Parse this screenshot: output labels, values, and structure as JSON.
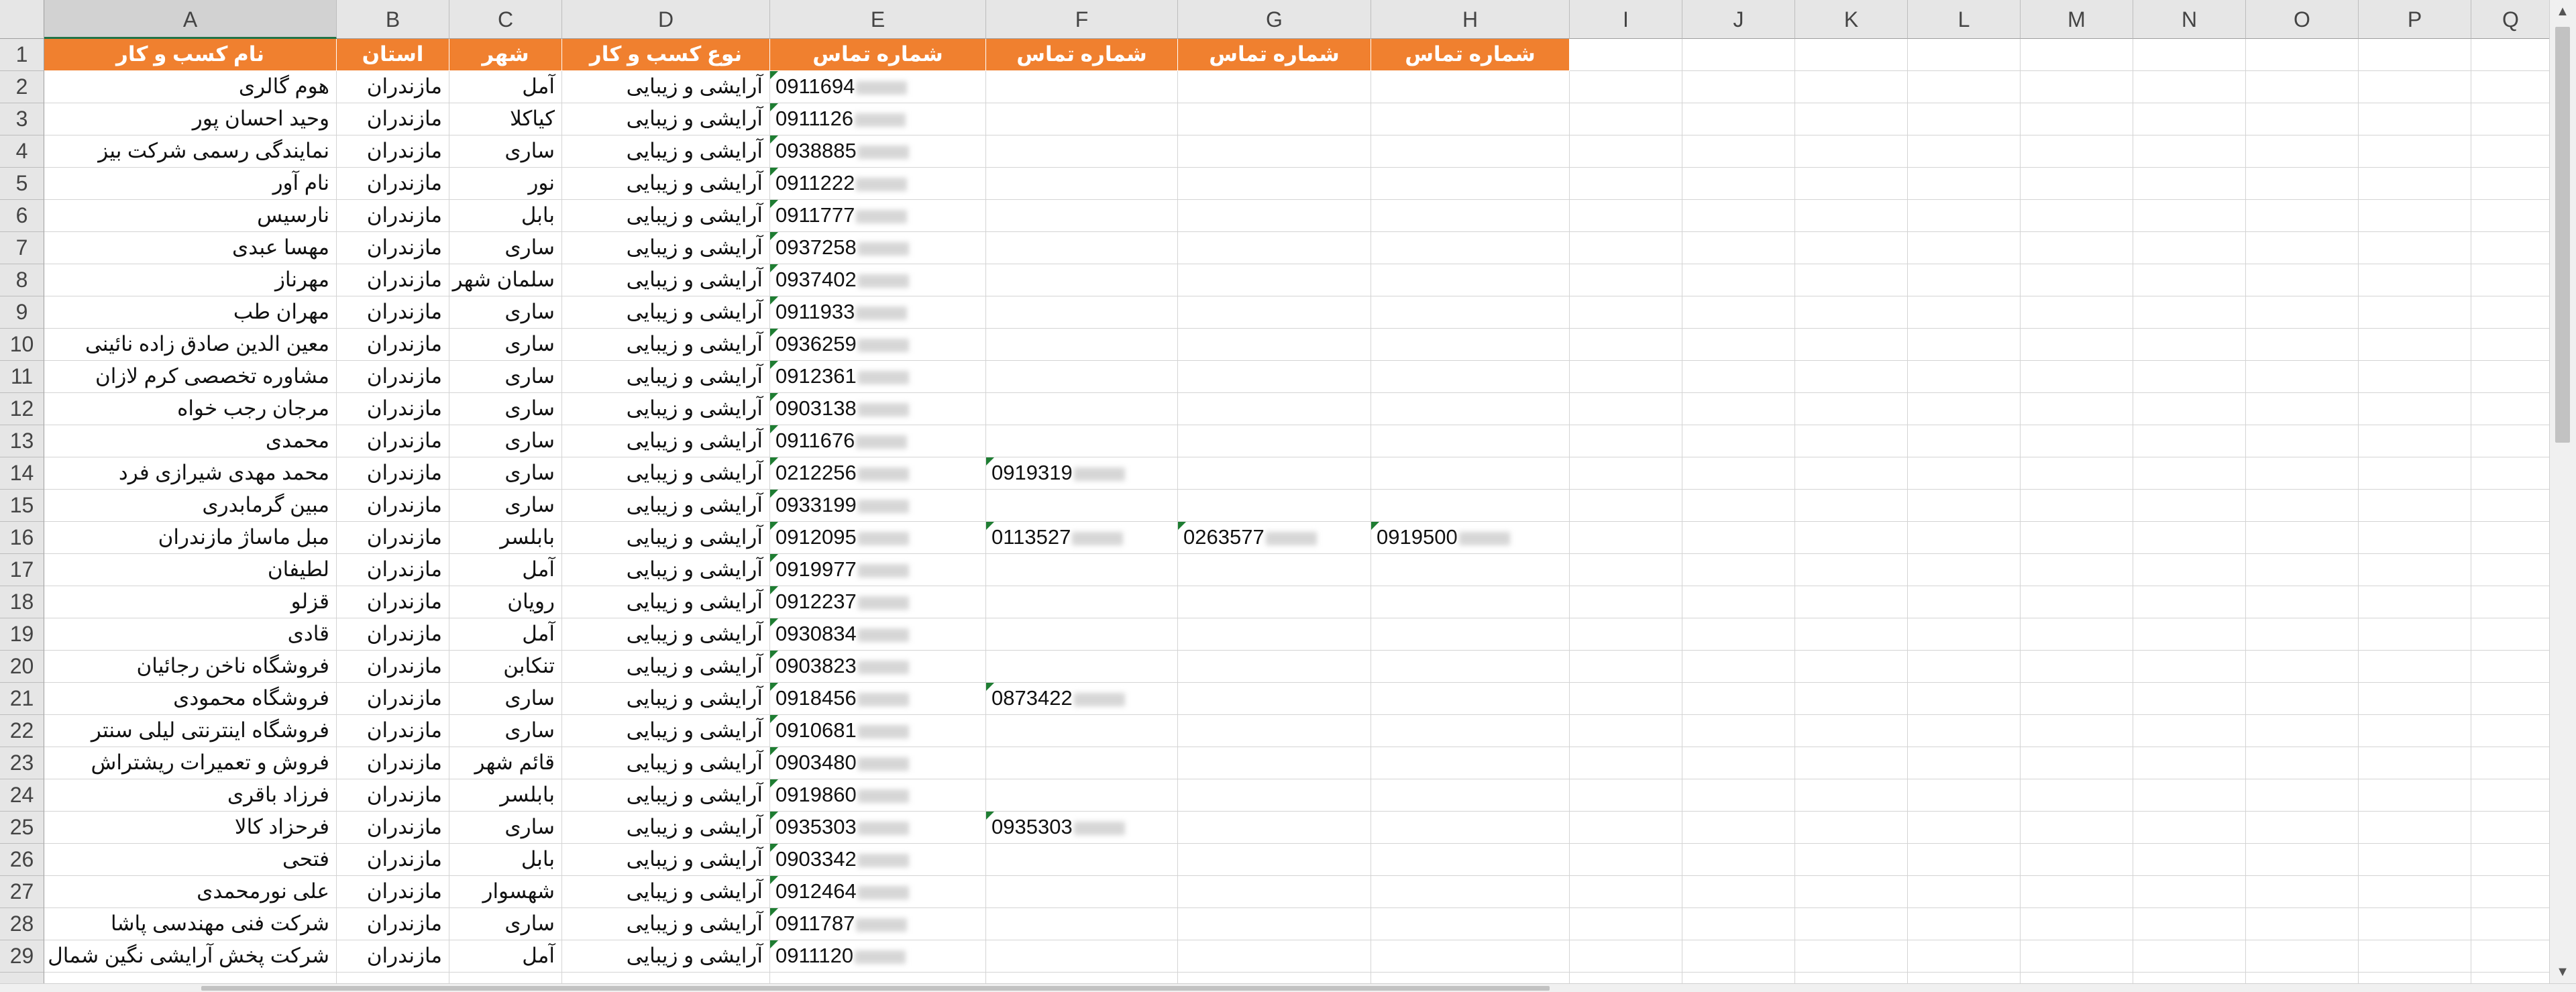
{
  "sheet": {
    "columns": [
      "A",
      "B",
      "C",
      "D",
      "E",
      "F",
      "G",
      "H",
      "I",
      "J",
      "K",
      "L",
      "M",
      "N",
      "O",
      "P",
      "Q"
    ],
    "selected_column": "A",
    "header_color": "#f0802f",
    "header": [
      "نام کسب و کار",
      "استان",
      "شهر",
      "نوع کسب و کار",
      "شماره تماس",
      "شماره تماس",
      "شماره تماس",
      "شماره تماس"
    ],
    "rows": [
      {
        "num": "2",
        "name": "هوم گالری",
        "province": "مازندران",
        "city": "آمل",
        "type": "آرایشی و زیبایی",
        "e": "0911694",
        "f": "",
        "g": "",
        "h": ""
      },
      {
        "num": "3",
        "name": "وحید احسان پور",
        "province": "مازندران",
        "city": "کیاکلا",
        "type": "آرایشی و زیبایی",
        "e": "0911126",
        "f": "",
        "g": "",
        "h": ""
      },
      {
        "num": "4",
        "name": "نمایندگی رسمی شرکت بیز",
        "province": "مازندران",
        "city": "ساری",
        "type": "آرایشی و زیبایی",
        "e": "0938885",
        "f": "",
        "g": "",
        "h": ""
      },
      {
        "num": "5",
        "name": "نام آور",
        "province": "مازندران",
        "city": "نور",
        "type": "آرایشی و زیبایی",
        "e": "0911222",
        "f": "",
        "g": "",
        "h": ""
      },
      {
        "num": "6",
        "name": "نارسیس",
        "province": "مازندران",
        "city": "بابل",
        "type": "آرایشی و زیبایی",
        "e": "0911777",
        "f": "",
        "g": "",
        "h": ""
      },
      {
        "num": "7",
        "name": "مهسا عبدی",
        "province": "مازندران",
        "city": "ساری",
        "type": "آرایشی و زیبایی",
        "e": "0937258",
        "f": "",
        "g": "",
        "h": ""
      },
      {
        "num": "8",
        "name": "مهرناز",
        "province": "مازندران",
        "city": "سلمان شهر",
        "type": "آرایشی و زیبایی",
        "e": "0937402",
        "f": "",
        "g": "",
        "h": ""
      },
      {
        "num": "9",
        "name": "مهران طب",
        "province": "مازندران",
        "city": "ساری",
        "type": "آرایشی و زیبایی",
        "e": "0911933",
        "f": "",
        "g": "",
        "h": ""
      },
      {
        "num": "10",
        "name": "معین الدین صادق زاده نائینی",
        "province": "مازندران",
        "city": "ساری",
        "type": "آرایشی و زیبایی",
        "e": "0936259",
        "f": "",
        "g": "",
        "h": ""
      },
      {
        "num": "11",
        "name": "مشاوره تخصصی کرم لازان",
        "province": "مازندران",
        "city": "ساری",
        "type": "آرایشی و زیبایی",
        "e": "0912361",
        "f": "",
        "g": "",
        "h": ""
      },
      {
        "num": "12",
        "name": "مرجان رجب خواه",
        "province": "مازندران",
        "city": "ساری",
        "type": "آرایشی و زیبایی",
        "e": "0903138",
        "f": "",
        "g": "",
        "h": ""
      },
      {
        "num": "13",
        "name": "محمدی",
        "province": "مازندران",
        "city": "ساری",
        "type": "آرایشی و زیبایی",
        "e": "0911676",
        "f": "",
        "g": "",
        "h": ""
      },
      {
        "num": "14",
        "name": "محمد مهدی شیرازی فرد",
        "province": "مازندران",
        "city": "ساری",
        "type": "آرایشی و زیبایی",
        "e": "0212256",
        "f": "0919319",
        "g": "",
        "h": ""
      },
      {
        "num": "15",
        "name": "مبین گرمابدری",
        "province": "مازندران",
        "city": "ساری",
        "type": "آرایشی و زیبایی",
        "e": "0933199",
        "f": "",
        "g": "",
        "h": ""
      },
      {
        "num": "16",
        "name": "مبل ماساژ مازندران",
        "province": "مازندران",
        "city": "بابلسر",
        "type": "آرایشی و زیبایی",
        "e": "0912095",
        "f": "0113527",
        "g": "0263577",
        "h": "0919500"
      },
      {
        "num": "17",
        "name": "لطیفان",
        "province": "مازندران",
        "city": "آمل",
        "type": "آرایشی و زیبایی",
        "e": "0919977",
        "f": "",
        "g": "",
        "h": ""
      },
      {
        "num": "18",
        "name": "قزلو",
        "province": "مازندران",
        "city": "رویان",
        "type": "آرایشی و زیبایی",
        "e": "0912237",
        "f": "",
        "g": "",
        "h": ""
      },
      {
        "num": "19",
        "name": "قادی",
        "province": "مازندران",
        "city": "آمل",
        "type": "آرایشی و زیبایی",
        "e": "0930834",
        "f": "",
        "g": "",
        "h": ""
      },
      {
        "num": "20",
        "name": "فروشگاه ناخن رجائیان",
        "province": "مازندران",
        "city": "تنکابن",
        "type": "آرایشی و زیبایی",
        "e": "0903823",
        "f": "",
        "g": "",
        "h": ""
      },
      {
        "num": "21",
        "name": "فروشگاه محمودی",
        "province": "مازندران",
        "city": "ساری",
        "type": "آرایشی و زیبایی",
        "e": "0918456",
        "f": "0873422",
        "g": "",
        "h": ""
      },
      {
        "num": "22",
        "name": "فروشگاه اینترنتی لیلی سنتر",
        "province": "مازندران",
        "city": "ساری",
        "type": "آرایشی و زیبایی",
        "e": "0910681",
        "f": "",
        "g": "",
        "h": ""
      },
      {
        "num": "23",
        "name": "فروش و تعمیرات ریشتراش",
        "province": "مازندران",
        "city": "قائم شهر",
        "type": "آرایشی و زیبایی",
        "e": "0903480",
        "f": "",
        "g": "",
        "h": ""
      },
      {
        "num": "24",
        "name": "فرزاد باقری",
        "province": "مازندران",
        "city": "بابلسر",
        "type": "آرایشی و زیبایی",
        "e": "0919860",
        "f": "",
        "g": "",
        "h": ""
      },
      {
        "num": "25",
        "name": "فرحزاد کالا",
        "province": "مازندران",
        "city": "ساری",
        "type": "آرایشی و زیبایی",
        "e": "0935303",
        "f": "0935303",
        "g": "",
        "h": ""
      },
      {
        "num": "26",
        "name": "فتحی",
        "province": "مازندران",
        "city": "بابل",
        "type": "آرایشی و زیبایی",
        "e": "0903342",
        "f": "",
        "g": "",
        "h": ""
      },
      {
        "num": "27",
        "name": "علی نورمحمدی",
        "province": "مازندران",
        "city": "شهسوار",
        "type": "آرایشی و زیبایی",
        "e": "0912464",
        "f": "",
        "g": "",
        "h": ""
      },
      {
        "num": "28",
        "name": "شرکت فنی مهندسی پاشا",
        "province": "مازندران",
        "city": "ساری",
        "type": "آرایشی و زیبایی",
        "e": "0911787",
        "f": "",
        "g": "",
        "h": ""
      },
      {
        "num": "29",
        "name": "شرکت پخش آرایشی نگین شمال",
        "province": "مازندران",
        "city": "آمل",
        "type": "آرایشی و زیبایی",
        "e": "0911120",
        "f": "",
        "g": "",
        "h": ""
      }
    ]
  }
}
